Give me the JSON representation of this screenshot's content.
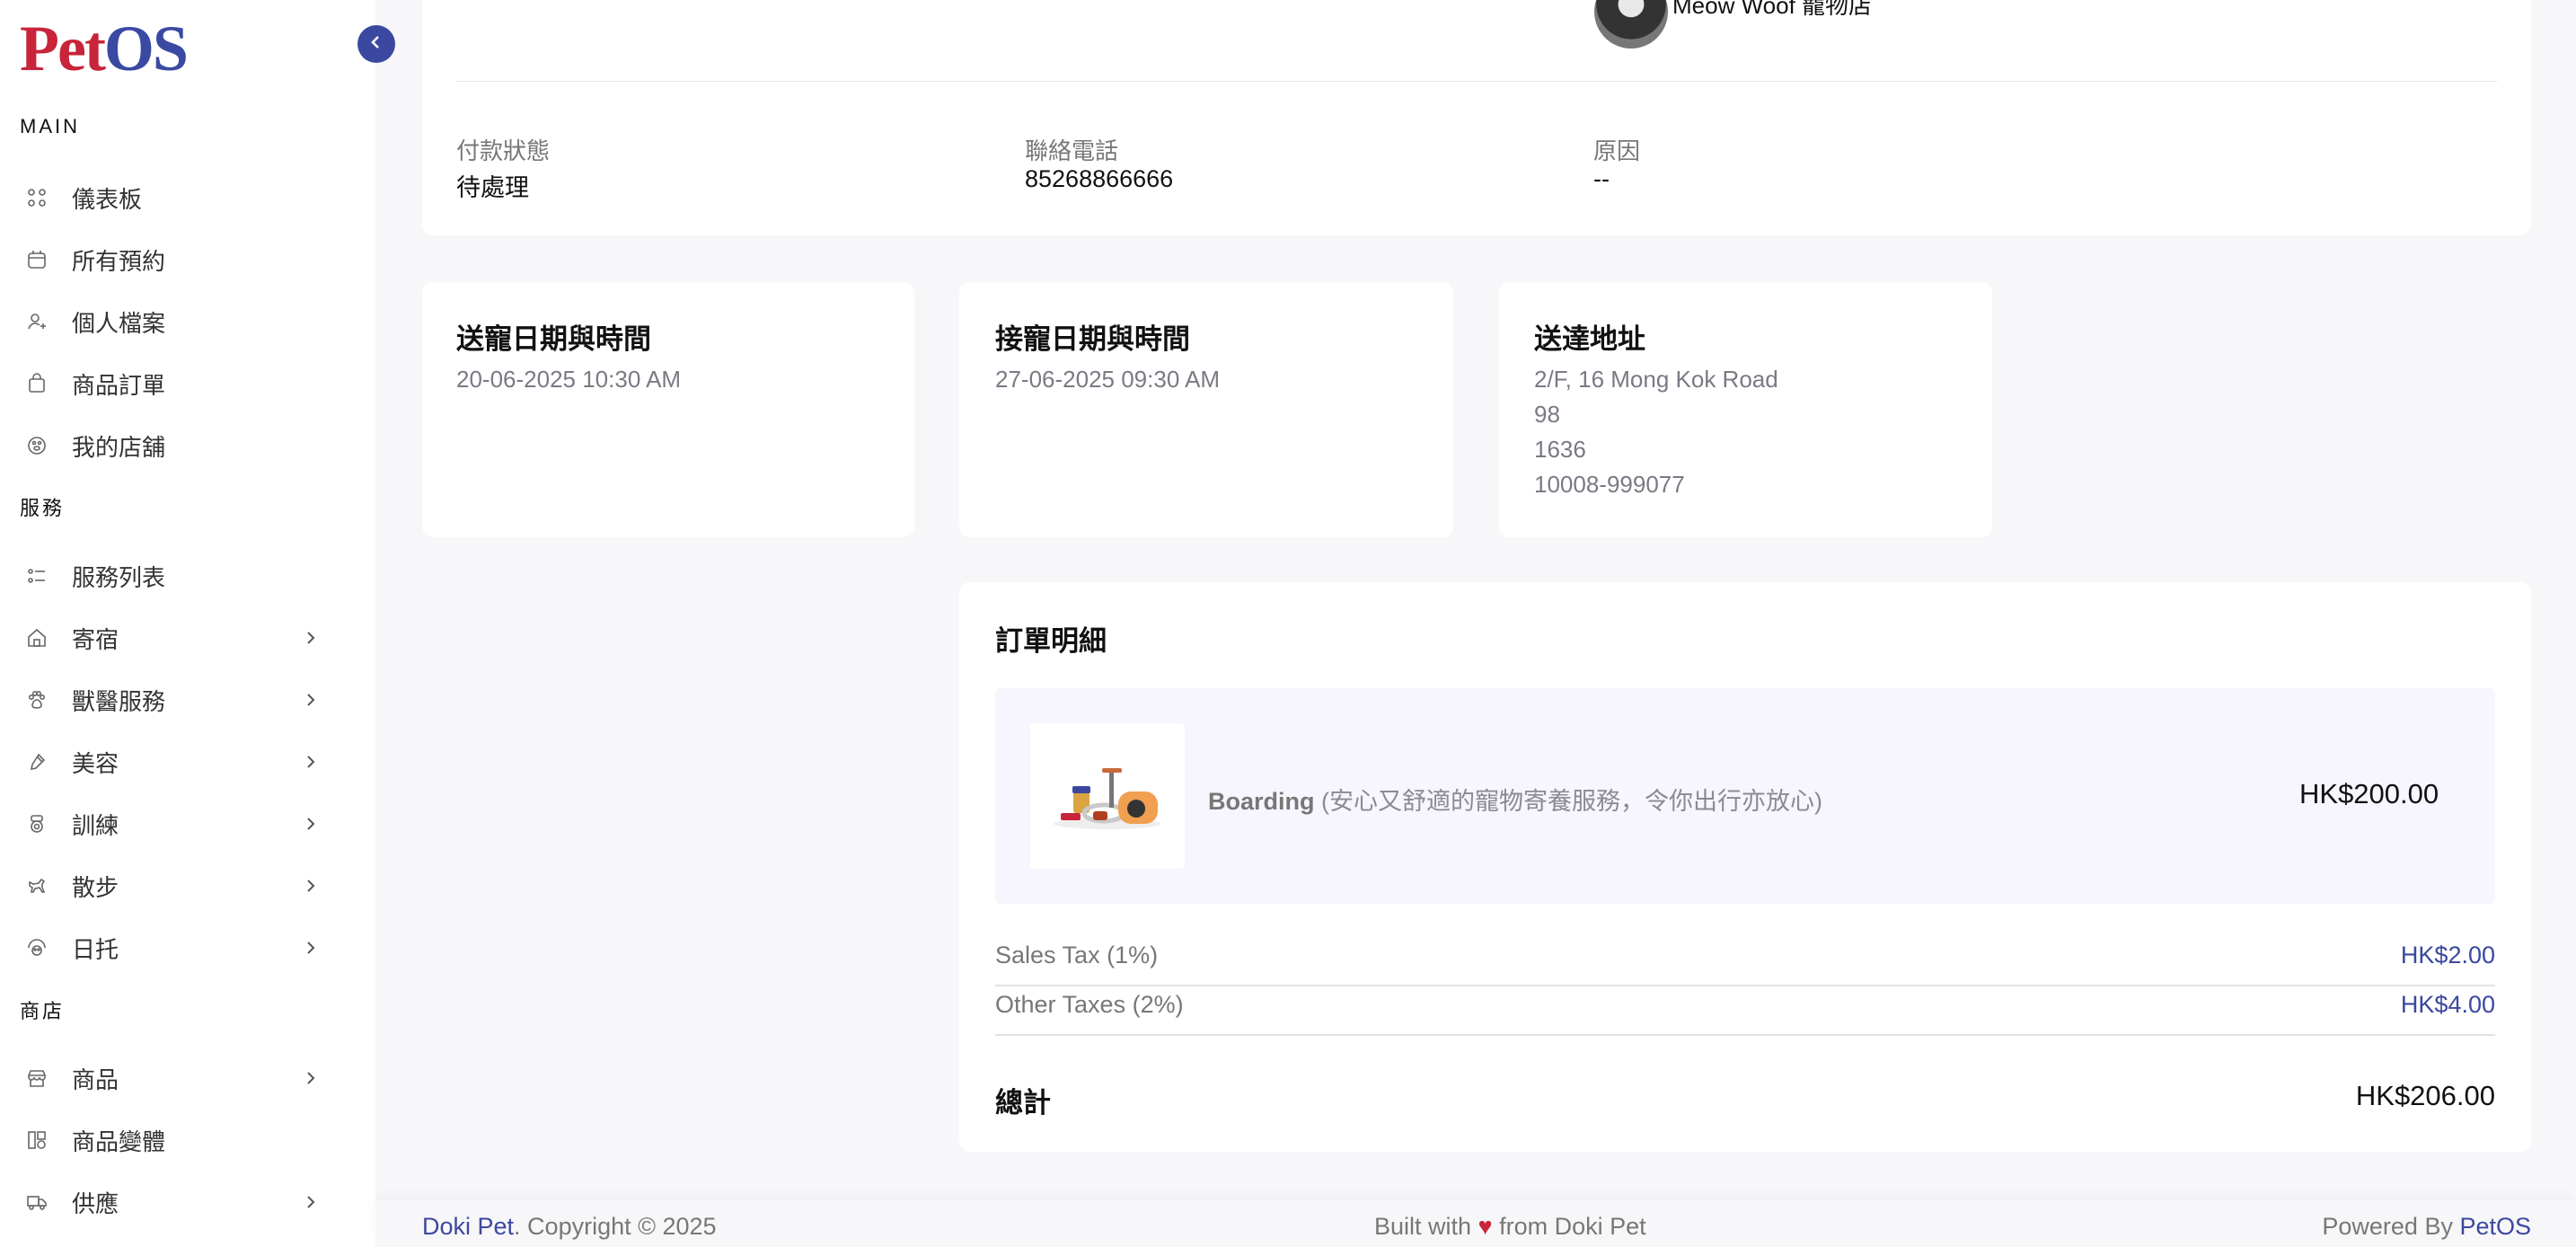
{
  "logo": {
    "pet": "Pet",
    "os": "OS"
  },
  "sidebar": {
    "main_label": "MAIN",
    "main_items": [
      {
        "label": "儀表板",
        "icon": "grid-icon"
      },
      {
        "label": "所有預約",
        "icon": "calendar-icon"
      },
      {
        "label": "個人檔案",
        "icon": "user-plus-icon"
      },
      {
        "label": "商品訂單",
        "icon": "shopping-bag-icon"
      },
      {
        "label": "我的店舖",
        "icon": "paw-badge-icon"
      }
    ],
    "services_label": "服務",
    "services_items": [
      {
        "label": "服務列表",
        "icon": "list-icon"
      },
      {
        "label": "寄宿",
        "icon": "home-icon"
      },
      {
        "label": "獸醫服務",
        "icon": "paw-icon"
      },
      {
        "label": "美容",
        "icon": "brush-icon"
      },
      {
        "label": "訓練",
        "icon": "medal-icon"
      },
      {
        "label": "散步",
        "icon": "walking-dog-icon"
      },
      {
        "label": "日托",
        "icon": "daycare-icon"
      }
    ],
    "shop_label": "商店",
    "shop_items": [
      {
        "label": "商品",
        "icon": "store-icon"
      },
      {
        "label": "商品變體",
        "icon": "variants-icon"
      },
      {
        "label": "供應",
        "icon": "truck-icon"
      }
    ]
  },
  "header": {
    "store_name": "Meow Woof 寵物店"
  },
  "info": {
    "payment_status_label": "付款狀態",
    "payment_status_value": "待處理",
    "phone_label": "聯絡電話",
    "phone_value": "85268866666",
    "reason_label": "原因",
    "reason_value": "--"
  },
  "dropoff": {
    "title": "送寵日期與時間",
    "value": "20-06-2025 10:30 AM"
  },
  "pickup": {
    "title": "接寵日期與時間",
    "value": "27-06-2025 09:30 AM"
  },
  "address": {
    "title": "送達地址",
    "lines": [
      "2/F, 16 Mong Kok Road",
      "98",
      "1636",
      "10008-999077"
    ]
  },
  "order": {
    "title": "訂單明細",
    "item_name": "Boarding",
    "item_desc": "(安心又舒適的寵物寄養服務，令你出行亦放心)",
    "item_price": "HK$200.00",
    "sales_tax_label": "Sales Tax (1%)",
    "sales_tax_value": "HK$2.00",
    "other_tax_label": "Other Taxes (2%)",
    "other_tax_value": "HK$4.00",
    "total_label": "總計",
    "total_value": "HK$206.00"
  },
  "footer": {
    "brand": "Doki Pet",
    "copyright": ". Copyright © 2025",
    "built_prefix": "Built with ",
    "heart": "♥",
    "built_suffix": " from Doki Pet",
    "powered_prefix": "Powered By ",
    "powered_brand": "PetOS"
  },
  "colors": {
    "accent": "#3b48a0",
    "brand_red": "#c8243a",
    "row_bg": "#f7f5fd"
  }
}
